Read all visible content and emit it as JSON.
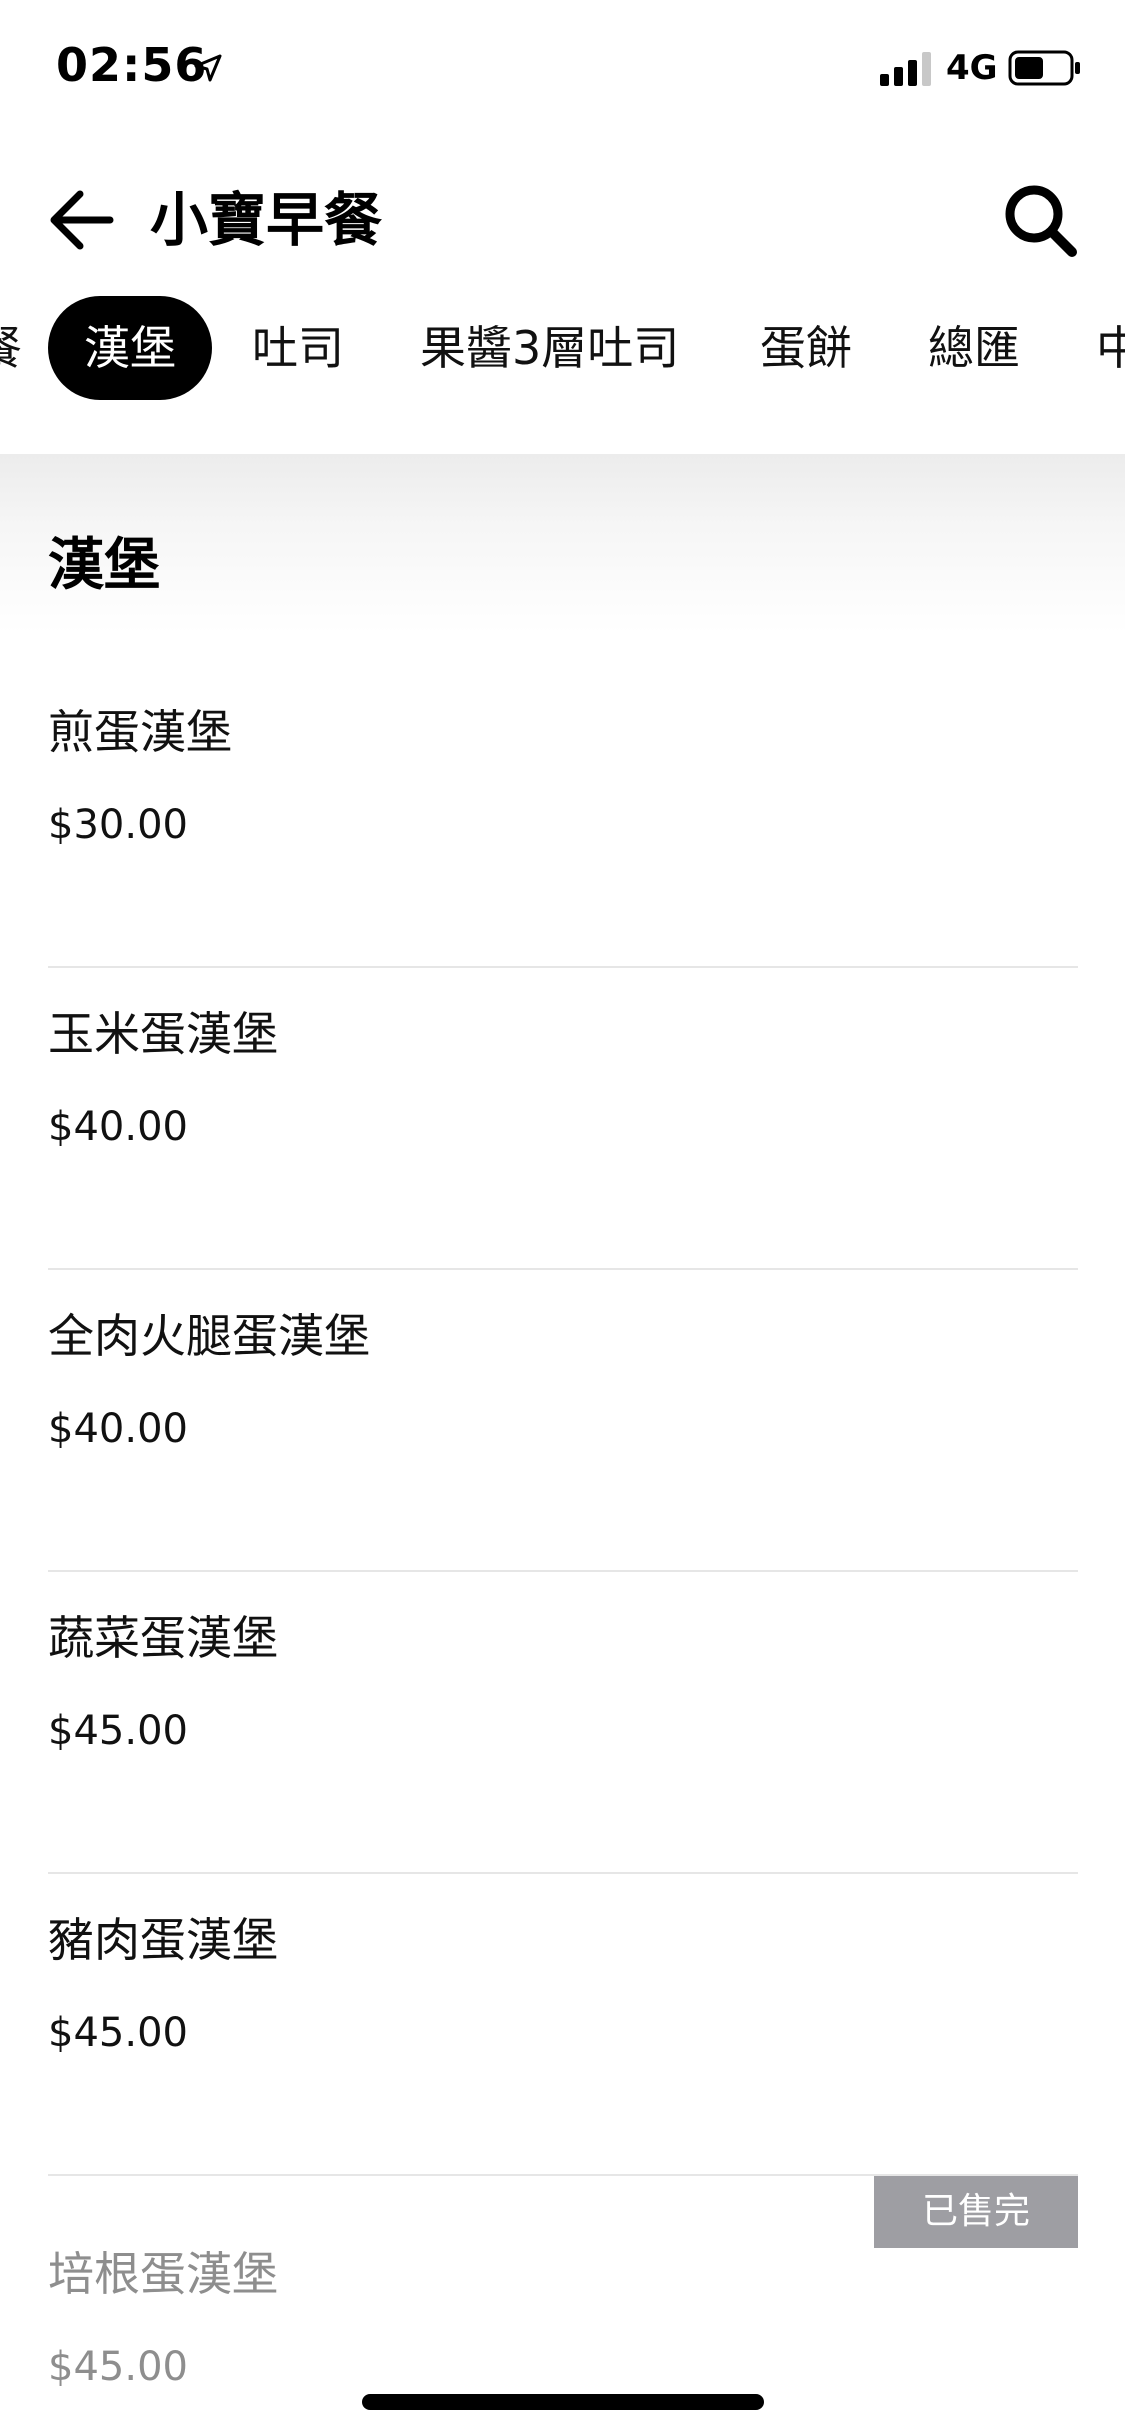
{
  "status_bar": {
    "time": "02:56",
    "network": "4G",
    "icons": [
      "location-arrow-icon",
      "signal-icon",
      "battery-icon"
    ]
  },
  "header": {
    "title": "小寶早餐",
    "back_icon": "arrow-left-icon",
    "search_icon": "search-icon"
  },
  "tabs": [
    {
      "label": "餐",
      "active": false
    },
    {
      "label": "漢堡",
      "active": true
    },
    {
      "label": "吐司",
      "active": false
    },
    {
      "label": "果醬3層吐司",
      "active": false
    },
    {
      "label": "蛋餅",
      "active": false
    },
    {
      "label": "總匯",
      "active": false
    },
    {
      "label": "中",
      "active": false
    }
  ],
  "section": {
    "title": "漢堡"
  },
  "items": [
    {
      "name": "煎蛋漢堡",
      "price": "$30.00",
      "sold_out": false
    },
    {
      "name": "玉米蛋漢堡",
      "price": "$40.00",
      "sold_out": false
    },
    {
      "name": "全肉火腿蛋漢堡",
      "price": "$40.00",
      "sold_out": false
    },
    {
      "name": "蔬菜蛋漢堡",
      "price": "$45.00",
      "sold_out": false
    },
    {
      "name": "豬肉蛋漢堡",
      "price": "$45.00",
      "sold_out": false
    },
    {
      "name": "培根蛋漢堡",
      "price": "$45.00",
      "sold_out": true,
      "badge": "已售完"
    }
  ],
  "colors": {
    "accent": "#000000",
    "soldout_badge": "#9e9ea3",
    "soldout_text": "#8e8e8e",
    "divider": "#e6e6e6"
  }
}
